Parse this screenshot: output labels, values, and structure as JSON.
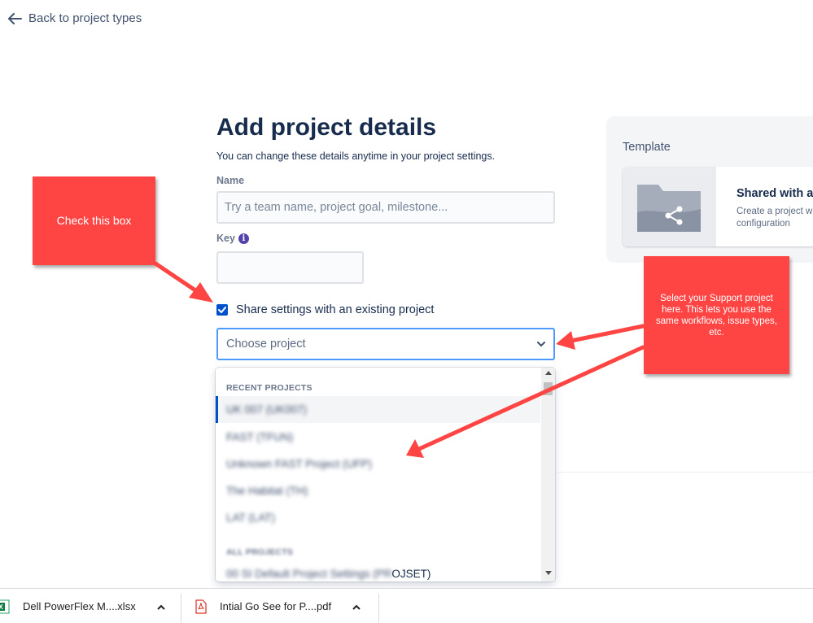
{
  "nav": {
    "back_label": "Back to project types"
  },
  "form": {
    "title": "Add project details",
    "subtitle": "You can change these details anytime in your project settings.",
    "name_label": "Name",
    "name_placeholder": "Try a team name, project goal, milestone...",
    "key_label": "Key",
    "share_label": "Share settings with an existing project",
    "share_checked": true,
    "select_placeholder": "Choose project"
  },
  "dropdown": {
    "recent_heading": "RECENT PROJECTS",
    "recent": [
      "UK 007 (UK007)",
      "FAST (TFUN)",
      "Unknown FAST Project (UFP)",
      "The Habitat (TH)",
      "LAT (LAT)"
    ],
    "all_heading": "ALL PROJECTS",
    "all_blurred": "00 SI Default Project Settings (PR",
    "all_visible_tail": "OJSET)"
  },
  "template": {
    "heading": "Template",
    "card_title": "Shared with an",
    "card_desc_1": "Create a project wi",
    "card_desc_2": "configuration"
  },
  "annotations": {
    "callout_1": "Check this box",
    "callout_2": "Select your Support project here. This lets you use the same workflows, issue types, etc."
  },
  "downloads": [
    {
      "name": "Dell PowerFlex M....xlsx",
      "icon": "excel-icon"
    },
    {
      "name": "Intial Go See for P....pdf",
      "icon": "pdf-icon"
    }
  ],
  "colors": {
    "accent": "#0052cc",
    "focus_border": "#4c9aff",
    "callout": "#ff4444",
    "info": "#5243aa"
  }
}
